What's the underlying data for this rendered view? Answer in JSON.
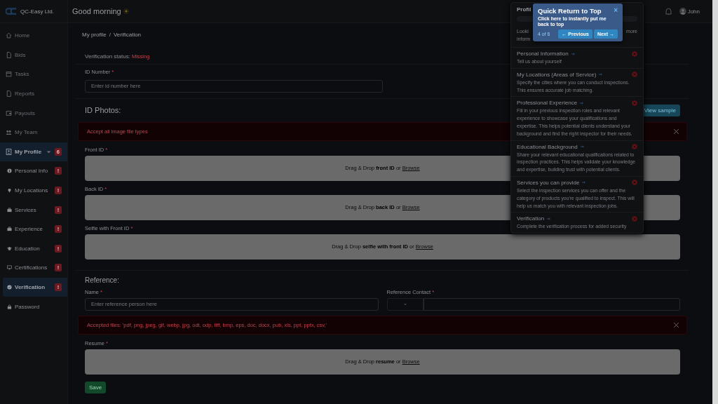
{
  "sidebar": {
    "brand": "QC-Easy Ltd.",
    "items": [
      {
        "label": "Home",
        "selected": false
      },
      {
        "label": "Bids",
        "selected": false
      },
      {
        "label": "Tasks",
        "selected": false
      },
      {
        "label": "Reports",
        "selected": false
      },
      {
        "label": "Payouts",
        "selected": false
      },
      {
        "label": "My Team",
        "selected": false
      },
      {
        "label": "My Profile",
        "selected": true,
        "expanded": true,
        "badge": "6",
        "children": [
          {
            "label": "Personal Info",
            "selected": false,
            "badge": "!"
          },
          {
            "label": "My Locations",
            "selected": false,
            "badge": "!"
          },
          {
            "label": "Services",
            "selected": false,
            "badge": "!"
          },
          {
            "label": "Experience",
            "selected": false,
            "badge": "!"
          },
          {
            "label": "Education",
            "selected": false,
            "badge": "!"
          },
          {
            "label": "Certifications",
            "selected": false,
            "badge": "!"
          },
          {
            "label": "Verification",
            "selected": true,
            "badge": "!"
          },
          {
            "label": "Password",
            "selected": false
          }
        ]
      }
    ]
  },
  "header": {
    "greeting": "Good morning",
    "user": "John"
  },
  "breadcrumb": [
    {
      "label": "My profile"
    },
    {
      "label": "/"
    },
    {
      "label": "Verification"
    }
  ],
  "status": {
    "label": "Verification status:",
    "value": "Missing"
  },
  "id_number": {
    "label": "ID Number",
    "required_mark": "*",
    "placeholder": "Enter id number here"
  },
  "id_photos": {
    "title": "ID Photos:",
    "button": "View sample",
    "alert": "Accept all image file types",
    "uploads": [
      {
        "label": "Front ID",
        "required_mark": "*",
        "text": "Drag & Drop **front ID** or ",
        "link": "Browse"
      },
      {
        "label": "Back ID",
        "required_mark": "*",
        "text": "Drag & Drop **back ID** or ",
        "link": "Browse"
      },
      {
        "label": "Selfie with Front ID",
        "required_mark": "*",
        "text": "Drag & Drop **selfie with front ID** or ",
        "link": "Browse"
      }
    ]
  },
  "reference": {
    "title": "Reference:",
    "name": {
      "label": "Name",
      "required_mark": "*",
      "placeholder": "Enter reference person here"
    },
    "contact": {
      "label": "Reference Contact",
      "required_mark": "*"
    },
    "alert": "Accepted files: 'pdf, png, jpeg, gif, webp, jpg, odt, odp, tiff, bmp, eps, doc, docx, pub, xls, ppt, pptx, csv,'",
    "resume": {
      "label": "Resume",
      "required_mark": "*",
      "text": "Drag & Drop **resume** or ",
      "link": "Browse"
    },
    "save": "Save"
  },
  "profile_menu": {
    "title": "Profil",
    "intro": [
      "Looki",
      "more",
      "inform"
    ],
    "items": [
      {
        "title": "Personal Information",
        "description": "Tell us about yourself"
      },
      {
        "title": "My Locations (Areas of Service)",
        "description": "Specify the cities where you can conduct inspections. This ensures accurate job matching."
      },
      {
        "title": "Professional Experience",
        "description": "Fill in your previous inspection roles and relevant experience to showcase your qualifications and expertise. This helps potential clients understand your background and find the right inspector for their needs."
      },
      {
        "title": "Educational Background",
        "description": "Share your relevant educational qualifications related to inspection practices. This helps validate your knowledge and expertise, building trust with potential clients."
      },
      {
        "title": "Services you can provide",
        "description": "Select the inspection services you can offer and the category of products you're qualified to inspect. This will help us match you with relevant inspection jobs."
      },
      {
        "title": "Verification",
        "description": "Complete the verification process for added security"
      }
    ]
  },
  "tour": {
    "title": "Quick Return to Top",
    "text": "Click here to instantly put me back to top",
    "step": "4 of 6",
    "close": "×",
    "previous": "← Previous",
    "next": "Next →"
  }
}
